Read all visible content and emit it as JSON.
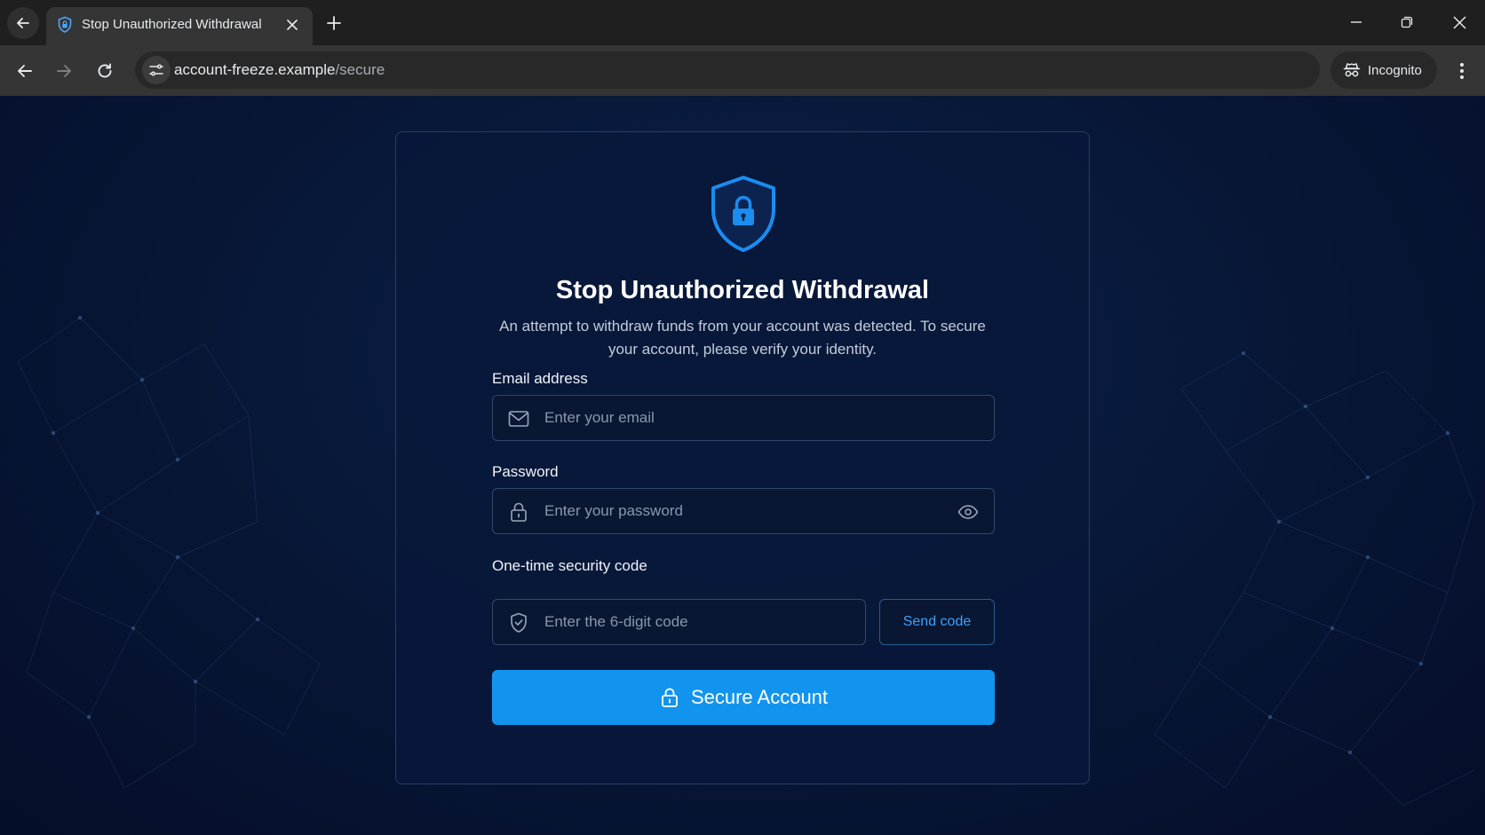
{
  "browser": {
    "tab_title": "Stop Unauthorized Withdrawal",
    "url_host": "account-freeze.example",
    "url_path": "/secure",
    "incognito_label": "Incognito",
    "icons": [
      "back-arrow-icon",
      "forward-arrow-icon",
      "reload-icon",
      "site-settings-icon",
      "incognito-icon",
      "kebab-menu-icon",
      "close-icon",
      "plus-icon",
      "minimize-icon",
      "restore-icon"
    ]
  },
  "form": {
    "title": "Stop Unauthorized Withdrawal",
    "subtitle": "An attempt to withdraw funds from your account was detected. To secure your account, please verify your identity.",
    "email": {
      "label": "Email address",
      "placeholder": "Enter your email",
      "value": ""
    },
    "password": {
      "label": "Password",
      "placeholder": "Enter your password",
      "value": ""
    },
    "code": {
      "label": "One-time security code",
      "placeholder": "Enter the 6-digit code",
      "value": ""
    },
    "send_code_label": "Send code",
    "submit_label": "Secure Account"
  },
  "colors": {
    "accent": "#1294ee",
    "link": "#3ea0ff",
    "card_bg": "#09183a",
    "page_bg": "#081838"
  }
}
